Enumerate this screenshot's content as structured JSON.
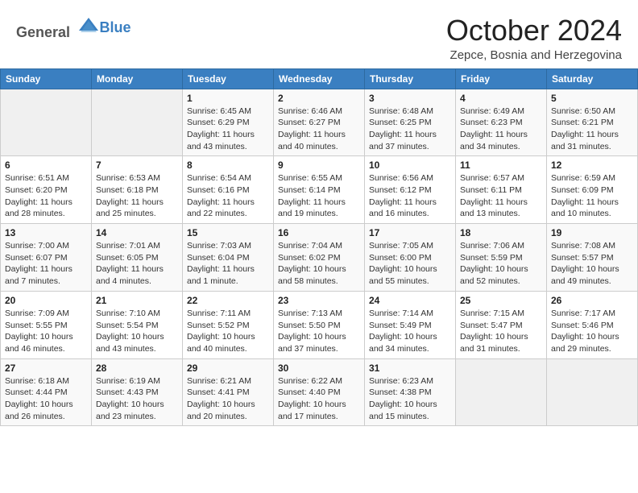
{
  "header": {
    "logo_general": "General",
    "logo_blue": "Blue",
    "month": "October 2024",
    "location": "Zepce, Bosnia and Herzegovina"
  },
  "days_of_week": [
    "Sunday",
    "Monday",
    "Tuesday",
    "Wednesday",
    "Thursday",
    "Friday",
    "Saturday"
  ],
  "weeks": [
    [
      {
        "day": "",
        "sunrise": "",
        "sunset": "",
        "daylight": ""
      },
      {
        "day": "",
        "sunrise": "",
        "sunset": "",
        "daylight": ""
      },
      {
        "day": "1",
        "sunrise": "Sunrise: 6:45 AM",
        "sunset": "Sunset: 6:29 PM",
        "daylight": "Daylight: 11 hours and 43 minutes."
      },
      {
        "day": "2",
        "sunrise": "Sunrise: 6:46 AM",
        "sunset": "Sunset: 6:27 PM",
        "daylight": "Daylight: 11 hours and 40 minutes."
      },
      {
        "day": "3",
        "sunrise": "Sunrise: 6:48 AM",
        "sunset": "Sunset: 6:25 PM",
        "daylight": "Daylight: 11 hours and 37 minutes."
      },
      {
        "day": "4",
        "sunrise": "Sunrise: 6:49 AM",
        "sunset": "Sunset: 6:23 PM",
        "daylight": "Daylight: 11 hours and 34 minutes."
      },
      {
        "day": "5",
        "sunrise": "Sunrise: 6:50 AM",
        "sunset": "Sunset: 6:21 PM",
        "daylight": "Daylight: 11 hours and 31 minutes."
      }
    ],
    [
      {
        "day": "6",
        "sunrise": "Sunrise: 6:51 AM",
        "sunset": "Sunset: 6:20 PM",
        "daylight": "Daylight: 11 hours and 28 minutes."
      },
      {
        "day": "7",
        "sunrise": "Sunrise: 6:53 AM",
        "sunset": "Sunset: 6:18 PM",
        "daylight": "Daylight: 11 hours and 25 minutes."
      },
      {
        "day": "8",
        "sunrise": "Sunrise: 6:54 AM",
        "sunset": "Sunset: 6:16 PM",
        "daylight": "Daylight: 11 hours and 22 minutes."
      },
      {
        "day": "9",
        "sunrise": "Sunrise: 6:55 AM",
        "sunset": "Sunset: 6:14 PM",
        "daylight": "Daylight: 11 hours and 19 minutes."
      },
      {
        "day": "10",
        "sunrise": "Sunrise: 6:56 AM",
        "sunset": "Sunset: 6:12 PM",
        "daylight": "Daylight: 11 hours and 16 minutes."
      },
      {
        "day": "11",
        "sunrise": "Sunrise: 6:57 AM",
        "sunset": "Sunset: 6:11 PM",
        "daylight": "Daylight: 11 hours and 13 minutes."
      },
      {
        "day": "12",
        "sunrise": "Sunrise: 6:59 AM",
        "sunset": "Sunset: 6:09 PM",
        "daylight": "Daylight: 11 hours and 10 minutes."
      }
    ],
    [
      {
        "day": "13",
        "sunrise": "Sunrise: 7:00 AM",
        "sunset": "Sunset: 6:07 PM",
        "daylight": "Daylight: 11 hours and 7 minutes."
      },
      {
        "day": "14",
        "sunrise": "Sunrise: 7:01 AM",
        "sunset": "Sunset: 6:05 PM",
        "daylight": "Daylight: 11 hours and 4 minutes."
      },
      {
        "day": "15",
        "sunrise": "Sunrise: 7:03 AM",
        "sunset": "Sunset: 6:04 PM",
        "daylight": "Daylight: 11 hours and 1 minute."
      },
      {
        "day": "16",
        "sunrise": "Sunrise: 7:04 AM",
        "sunset": "Sunset: 6:02 PM",
        "daylight": "Daylight: 10 hours and 58 minutes."
      },
      {
        "day": "17",
        "sunrise": "Sunrise: 7:05 AM",
        "sunset": "Sunset: 6:00 PM",
        "daylight": "Daylight: 10 hours and 55 minutes."
      },
      {
        "day": "18",
        "sunrise": "Sunrise: 7:06 AM",
        "sunset": "Sunset: 5:59 PM",
        "daylight": "Daylight: 10 hours and 52 minutes."
      },
      {
        "day": "19",
        "sunrise": "Sunrise: 7:08 AM",
        "sunset": "Sunset: 5:57 PM",
        "daylight": "Daylight: 10 hours and 49 minutes."
      }
    ],
    [
      {
        "day": "20",
        "sunrise": "Sunrise: 7:09 AM",
        "sunset": "Sunset: 5:55 PM",
        "daylight": "Daylight: 10 hours and 46 minutes."
      },
      {
        "day": "21",
        "sunrise": "Sunrise: 7:10 AM",
        "sunset": "Sunset: 5:54 PM",
        "daylight": "Daylight: 10 hours and 43 minutes."
      },
      {
        "day": "22",
        "sunrise": "Sunrise: 7:11 AM",
        "sunset": "Sunset: 5:52 PM",
        "daylight": "Daylight: 10 hours and 40 minutes."
      },
      {
        "day": "23",
        "sunrise": "Sunrise: 7:13 AM",
        "sunset": "Sunset: 5:50 PM",
        "daylight": "Daylight: 10 hours and 37 minutes."
      },
      {
        "day": "24",
        "sunrise": "Sunrise: 7:14 AM",
        "sunset": "Sunset: 5:49 PM",
        "daylight": "Daylight: 10 hours and 34 minutes."
      },
      {
        "day": "25",
        "sunrise": "Sunrise: 7:15 AM",
        "sunset": "Sunset: 5:47 PM",
        "daylight": "Daylight: 10 hours and 31 minutes."
      },
      {
        "day": "26",
        "sunrise": "Sunrise: 7:17 AM",
        "sunset": "Sunset: 5:46 PM",
        "daylight": "Daylight: 10 hours and 29 minutes."
      }
    ],
    [
      {
        "day": "27",
        "sunrise": "Sunrise: 6:18 AM",
        "sunset": "Sunset: 4:44 PM",
        "daylight": "Daylight: 10 hours and 26 minutes."
      },
      {
        "day": "28",
        "sunrise": "Sunrise: 6:19 AM",
        "sunset": "Sunset: 4:43 PM",
        "daylight": "Daylight: 10 hours and 23 minutes."
      },
      {
        "day": "29",
        "sunrise": "Sunrise: 6:21 AM",
        "sunset": "Sunset: 4:41 PM",
        "daylight": "Daylight: 10 hours and 20 minutes."
      },
      {
        "day": "30",
        "sunrise": "Sunrise: 6:22 AM",
        "sunset": "Sunset: 4:40 PM",
        "daylight": "Daylight: 10 hours and 17 minutes."
      },
      {
        "day": "31",
        "sunrise": "Sunrise: 6:23 AM",
        "sunset": "Sunset: 4:38 PM",
        "daylight": "Daylight: 10 hours and 15 minutes."
      },
      {
        "day": "",
        "sunrise": "",
        "sunset": "",
        "daylight": ""
      },
      {
        "day": "",
        "sunrise": "",
        "sunset": "",
        "daylight": ""
      }
    ]
  ]
}
